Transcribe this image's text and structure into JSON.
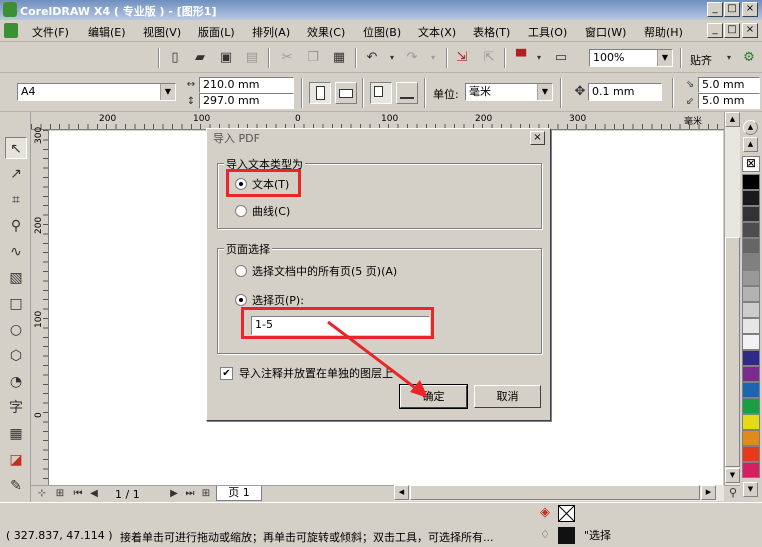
{
  "window": {
    "title": "CorelDRAW X4 ( 专业版 ) - [图形1]",
    "min": "_",
    "max": "□",
    "close": "×"
  },
  "menu": {
    "items": [
      "文件(F)",
      "编辑(E)",
      "视图(V)",
      "版面(L)",
      "排列(A)",
      "效果(C)",
      "位图(B)",
      "文本(X)",
      "表格(T)",
      "工具(O)",
      "窗口(W)",
      "帮助(H)"
    ]
  },
  "toolbar": {
    "zoom": "100%",
    "snap": "贴齐"
  },
  "property_bar": {
    "paper_size": "A4",
    "width": "210.0 mm",
    "height": "297.0 mm",
    "units_label": "单位:",
    "units": "毫米",
    "nudge": "0.1 mm",
    "dup_x": "5.0 mm",
    "dup_y": "5.0 mm"
  },
  "ruler": {
    "top_ticks": [
      "200",
      "100",
      "0",
      "100",
      "200",
      "300",
      "毫米"
    ],
    "left_ticks": [
      "300",
      "200",
      "100",
      "0"
    ]
  },
  "dialog": {
    "title": "导入 PDF",
    "close": "×",
    "import_text_group": "导入文本类型为",
    "opt_text": "文本(T)",
    "opt_curves": "曲线(C)",
    "page_group": "页面选择",
    "opt_all_pages": "选择文档中的所有页(5 页)(A)",
    "opt_select_pages": "选择页(P):",
    "pages_value": "1-5",
    "import_comments": "导入注释并放置在单独的图层上",
    "ok": "确定",
    "cancel": "取消"
  },
  "navigator": {
    "page_count": "1 / 1",
    "page_tab": "页 1"
  },
  "status": {
    "coords": "( 327.837, 47.114 )",
    "hint": "接着单击可进行拖动或缩放；再单击可旋转或倾斜；双击工具，可选择所有...",
    "hint_tail": "\"选择"
  },
  "palette_colors": [
    "#ffffff",
    "#000000",
    "#1a1a1a",
    "#333333",
    "#4d4d4d",
    "#666666",
    "#808080",
    "#999999",
    "#b3b3b3",
    "#cccccc",
    "#e6e6e6",
    "#f2f2f2",
    "#2e2a85",
    "#7b2a8e",
    "#1a66b3",
    "#1a9e44",
    "#e6d91a",
    "#e08a1a",
    "#e63a1a",
    "#d61e63"
  ]
}
